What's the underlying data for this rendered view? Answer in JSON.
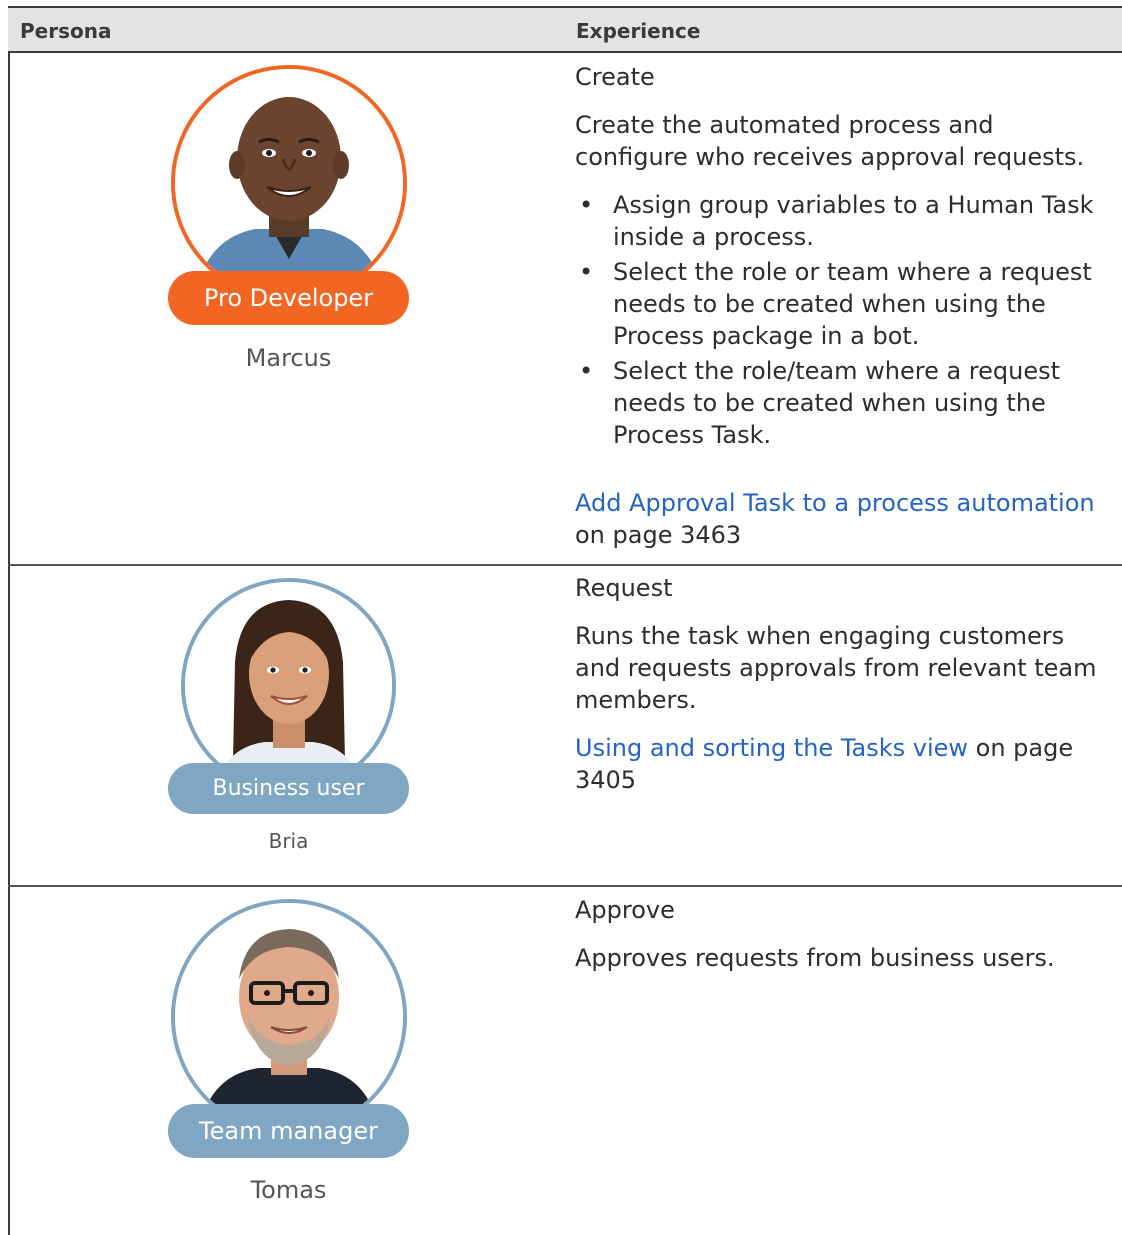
{
  "table": {
    "headers": [
      "Persona",
      "Experience"
    ]
  },
  "rows": [
    {
      "role": "Pro Developer",
      "name": "Marcus",
      "role_color": "#f26522",
      "heading": "Create",
      "description": "Create the automated process and configure who receives approval requests.",
      "bullets": [
        "Assign group variables to a Human Task inside a process.",
        "Select the role or team where a request needs to be created when using the Process package in a bot.",
        "Select the role/team where a request needs to be created when using the Process Task."
      ],
      "link_text": "Add Approval Task to a process automation",
      "link_suffix": "on page 3463"
    },
    {
      "role": "Business user",
      "name": "Bria",
      "role_color": "#7fa6c2",
      "heading": "Request",
      "description": "Runs the task when engaging customers and requests approvals from relevant team members.",
      "link_text": "Using and sorting the Tasks view",
      "link_suffix": "on page 3405"
    },
    {
      "role": "Team manager",
      "name": "Tomas",
      "role_color": "#7fa6c2",
      "heading": "Approve",
      "description": "Approves requests from business users."
    }
  ]
}
